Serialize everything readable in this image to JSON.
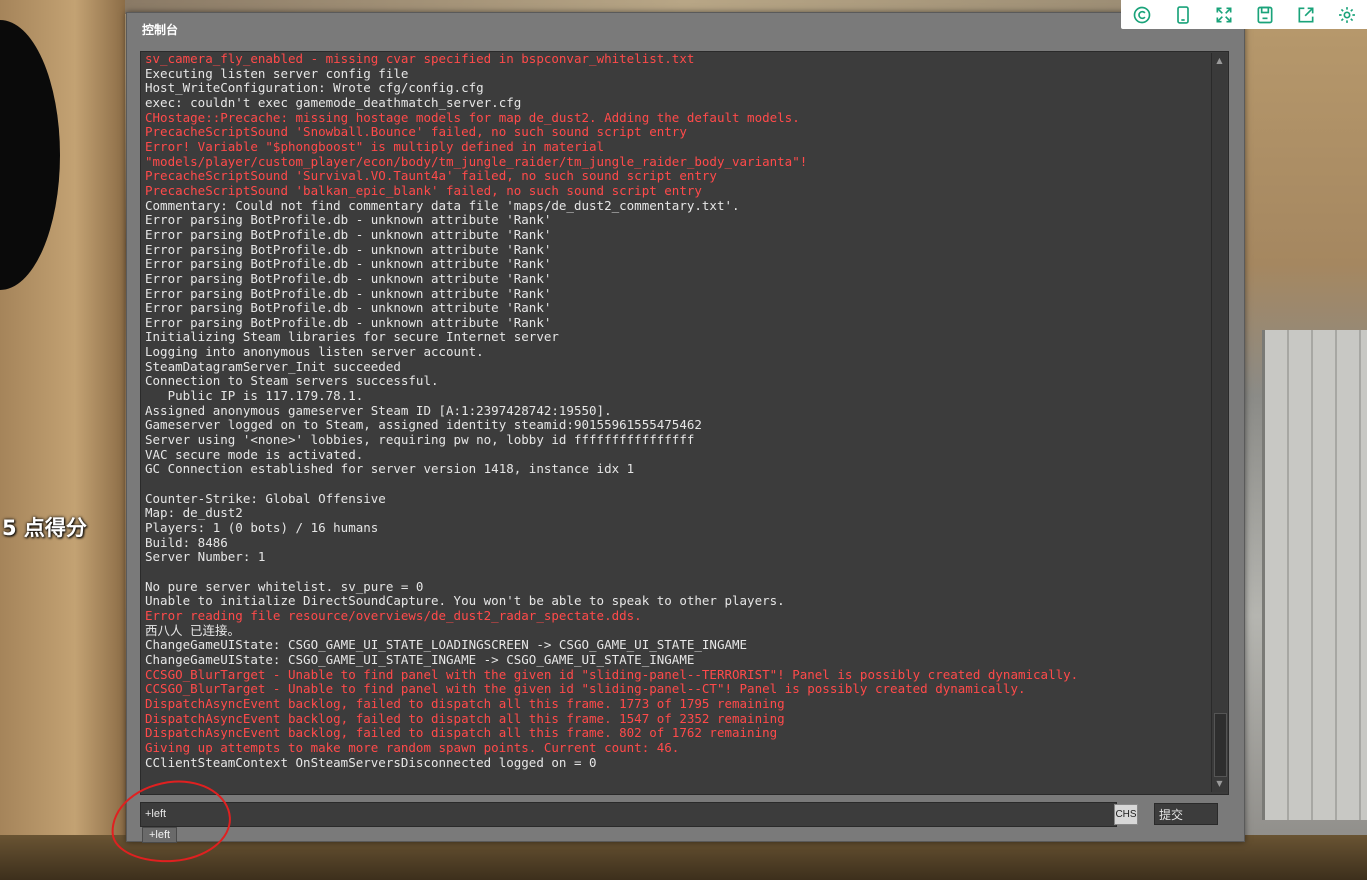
{
  "hud": {
    "score_text": "5 点得分"
  },
  "console": {
    "title": "控制台",
    "log": [
      {
        "text": "sv_camera_fly_enabled - missing cvar specified in bspconvar_whitelist.txt",
        "type": "err"
      },
      {
        "text": "Executing listen server config file",
        "type": "normal"
      },
      {
        "text": "Host_WriteConfiguration: Wrote cfg/config.cfg",
        "type": "normal"
      },
      {
        "text": "exec: couldn't exec gamemode_deathmatch_server.cfg",
        "type": "normal"
      },
      {
        "text": "CHostage::Precache: missing hostage models for map de_dust2. Adding the default models.",
        "type": "err"
      },
      {
        "text": "PrecacheScriptSound 'Snowball.Bounce' failed, no such sound script entry",
        "type": "err"
      },
      {
        "text": "Error! Variable \"$phongboost\" is multiply defined in material",
        "type": "err"
      },
      {
        "text": "\"models/player/custom_player/econ/body/tm_jungle_raider/tm_jungle_raider_body_varianta\"!",
        "type": "err"
      },
      {
        "text": "PrecacheScriptSound 'Survival.VO.Taunt4a' failed, no such sound script entry",
        "type": "err"
      },
      {
        "text": "PrecacheScriptSound 'balkan_epic_blank' failed, no such sound script entry",
        "type": "err"
      },
      {
        "text": "Commentary: Could not find commentary data file 'maps/de_dust2_commentary.txt'.",
        "type": "normal"
      },
      {
        "text": "Error parsing BotProfile.db - unknown attribute 'Rank'",
        "type": "normal"
      },
      {
        "text": "Error parsing BotProfile.db - unknown attribute 'Rank'",
        "type": "normal"
      },
      {
        "text": "Error parsing BotProfile.db - unknown attribute 'Rank'",
        "type": "normal"
      },
      {
        "text": "Error parsing BotProfile.db - unknown attribute 'Rank'",
        "type": "normal"
      },
      {
        "text": "Error parsing BotProfile.db - unknown attribute 'Rank'",
        "type": "normal"
      },
      {
        "text": "Error parsing BotProfile.db - unknown attribute 'Rank'",
        "type": "normal"
      },
      {
        "text": "Error parsing BotProfile.db - unknown attribute 'Rank'",
        "type": "normal"
      },
      {
        "text": "Error parsing BotProfile.db - unknown attribute 'Rank'",
        "type": "normal"
      },
      {
        "text": "Initializing Steam libraries for secure Internet server",
        "type": "normal"
      },
      {
        "text": "Logging into anonymous listen server account.",
        "type": "normal"
      },
      {
        "text": "SteamDatagramServer_Init succeeded",
        "type": "normal"
      },
      {
        "text": "Connection to Steam servers successful.",
        "type": "normal"
      },
      {
        "text": "   Public IP is 117.179.78.1.",
        "type": "normal"
      },
      {
        "text": "Assigned anonymous gameserver Steam ID [A:1:2397428742:19550].",
        "type": "normal"
      },
      {
        "text": "Gameserver logged on to Steam, assigned identity steamid:90155961555475462",
        "type": "normal"
      },
      {
        "text": "Server using '<none>' lobbies, requiring pw no, lobby id ffffffffffffffff",
        "type": "normal"
      },
      {
        "text": "VAC secure mode is activated.",
        "type": "normal"
      },
      {
        "text": "GC Connection established for server version 1418, instance idx 1",
        "type": "normal"
      },
      {
        "text": "",
        "type": "normal"
      },
      {
        "text": "Counter-Strike: Global Offensive",
        "type": "normal"
      },
      {
        "text": "Map: de_dust2",
        "type": "normal"
      },
      {
        "text": "Players: 1 (0 bots) / 16 humans",
        "type": "normal"
      },
      {
        "text": "Build: 8486",
        "type": "normal"
      },
      {
        "text": "Server Number: 1",
        "type": "normal"
      },
      {
        "text": "",
        "type": "normal"
      },
      {
        "text": "No pure server whitelist. sv_pure = 0",
        "type": "normal"
      },
      {
        "text": "Unable to initialize DirectSoundCapture. You won't be able to speak to other players.",
        "type": "normal"
      },
      {
        "text": "Error reading file resource/overviews/de_dust2_radar_spectate.dds.",
        "type": "err"
      },
      {
        "text": "西八人 已连接。",
        "type": "normal"
      },
      {
        "text": "ChangeGameUIState: CSGO_GAME_UI_STATE_LOADINGSCREEN -> CSGO_GAME_UI_STATE_INGAME",
        "type": "normal"
      },
      {
        "text": "ChangeGameUIState: CSGO_GAME_UI_STATE_INGAME -> CSGO_GAME_UI_STATE_INGAME",
        "type": "normal"
      },
      {
        "text": "CCSGO_BlurTarget - Unable to find panel with the given id \"sliding-panel--TERRORIST\"! Panel is possibly created dynamically.",
        "type": "err"
      },
      {
        "text": "CCSGO_BlurTarget - Unable to find panel with the given id \"sliding-panel--CT\"! Panel is possibly created dynamically.",
        "type": "err"
      },
      {
        "text": "DispatchAsyncEvent backlog, failed to dispatch all this frame. 1773 of 1795 remaining",
        "type": "err"
      },
      {
        "text": "DispatchAsyncEvent backlog, failed to dispatch all this frame. 1547 of 2352 remaining",
        "type": "err"
      },
      {
        "text": "DispatchAsyncEvent backlog, failed to dispatch all this frame. 802 of 1762 remaining",
        "type": "err"
      },
      {
        "text": "Giving up attempts to make more random spawn points. Current count: 46.",
        "type": "err"
      },
      {
        "text": "CClientSteamContext OnSteamServersDisconnected logged on = 0",
        "type": "normal"
      }
    ],
    "input": {
      "value": "+left"
    },
    "ime_indicator": "CHS",
    "submit_label": "提交",
    "autocomplete": [
      "+left"
    ]
  },
  "toolbar": {
    "buttons": [
      {
        "icon": "copyright-circle-icon"
      },
      {
        "icon": "phone-icon"
      },
      {
        "icon": "fullscreen-icon"
      },
      {
        "icon": "save-icon"
      },
      {
        "icon": "share-icon"
      },
      {
        "icon": "gear-icon"
      }
    ]
  },
  "colors": {
    "console_bg": "#3c3c3c",
    "frame_bg": "#7a7a7a",
    "error_text": "#ff4a4a",
    "normal_text": "#e6e6e6",
    "toolbar_icon": "#1aa37a",
    "annotation": "#e02020"
  }
}
